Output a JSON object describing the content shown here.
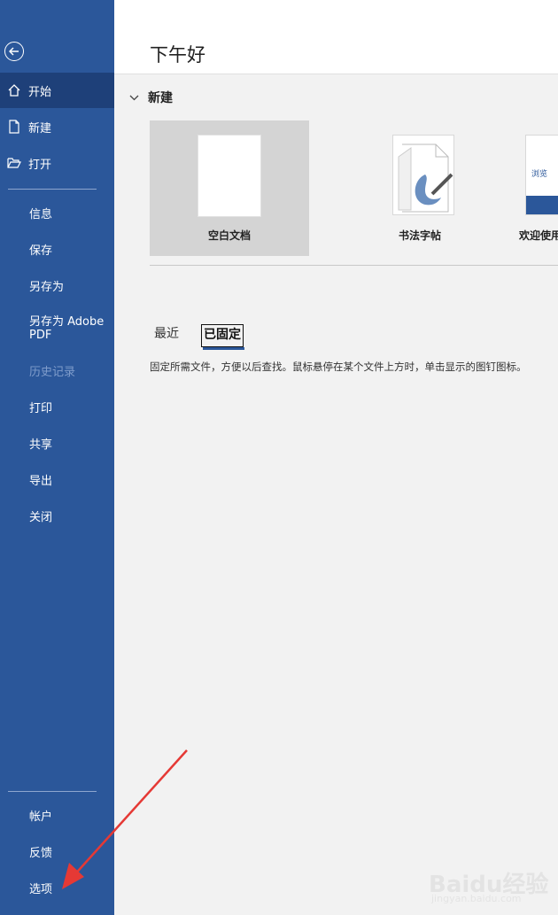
{
  "sidebar": {
    "back_icon": "back-arrow-icon",
    "primary": [
      {
        "label": "开始",
        "icon": "home-icon",
        "active": true
      },
      {
        "label": "新建",
        "icon": "new-document-icon"
      },
      {
        "label": "打开",
        "icon": "open-folder-icon"
      }
    ],
    "secondary": [
      {
        "label": "信息"
      },
      {
        "label": "保存"
      },
      {
        "label": "另存为"
      },
      {
        "label": "另存为 Adobe PDF"
      },
      {
        "label": "历史记录",
        "disabled": true
      },
      {
        "label": "打印"
      },
      {
        "label": "共享"
      },
      {
        "label": "导出"
      },
      {
        "label": "关闭"
      }
    ],
    "bottom": [
      {
        "label": "帐户"
      },
      {
        "label": "反馈"
      },
      {
        "label": "选项"
      }
    ],
    "color": "#2b579a"
  },
  "main": {
    "greeting": "下午好",
    "new_section": {
      "title": "新建",
      "templates": [
        {
          "label": "空白文档",
          "selected": true
        },
        {
          "label": "书法字帖"
        },
        {
          "label": "欢迎使用",
          "thumb_text": "浏览"
        }
      ]
    },
    "tabs": [
      {
        "label": "最近"
      },
      {
        "label": "已固定",
        "active": true
      }
    ],
    "pinned_hint": "固定所需文件，方便以后查找。鼠标悬停在某个文件上方时，单击显示的图钉图标。"
  },
  "watermark": {
    "logo": "Baidu经验",
    "url": "jingyan.baidu.com"
  },
  "annotation_color": "#e53935"
}
